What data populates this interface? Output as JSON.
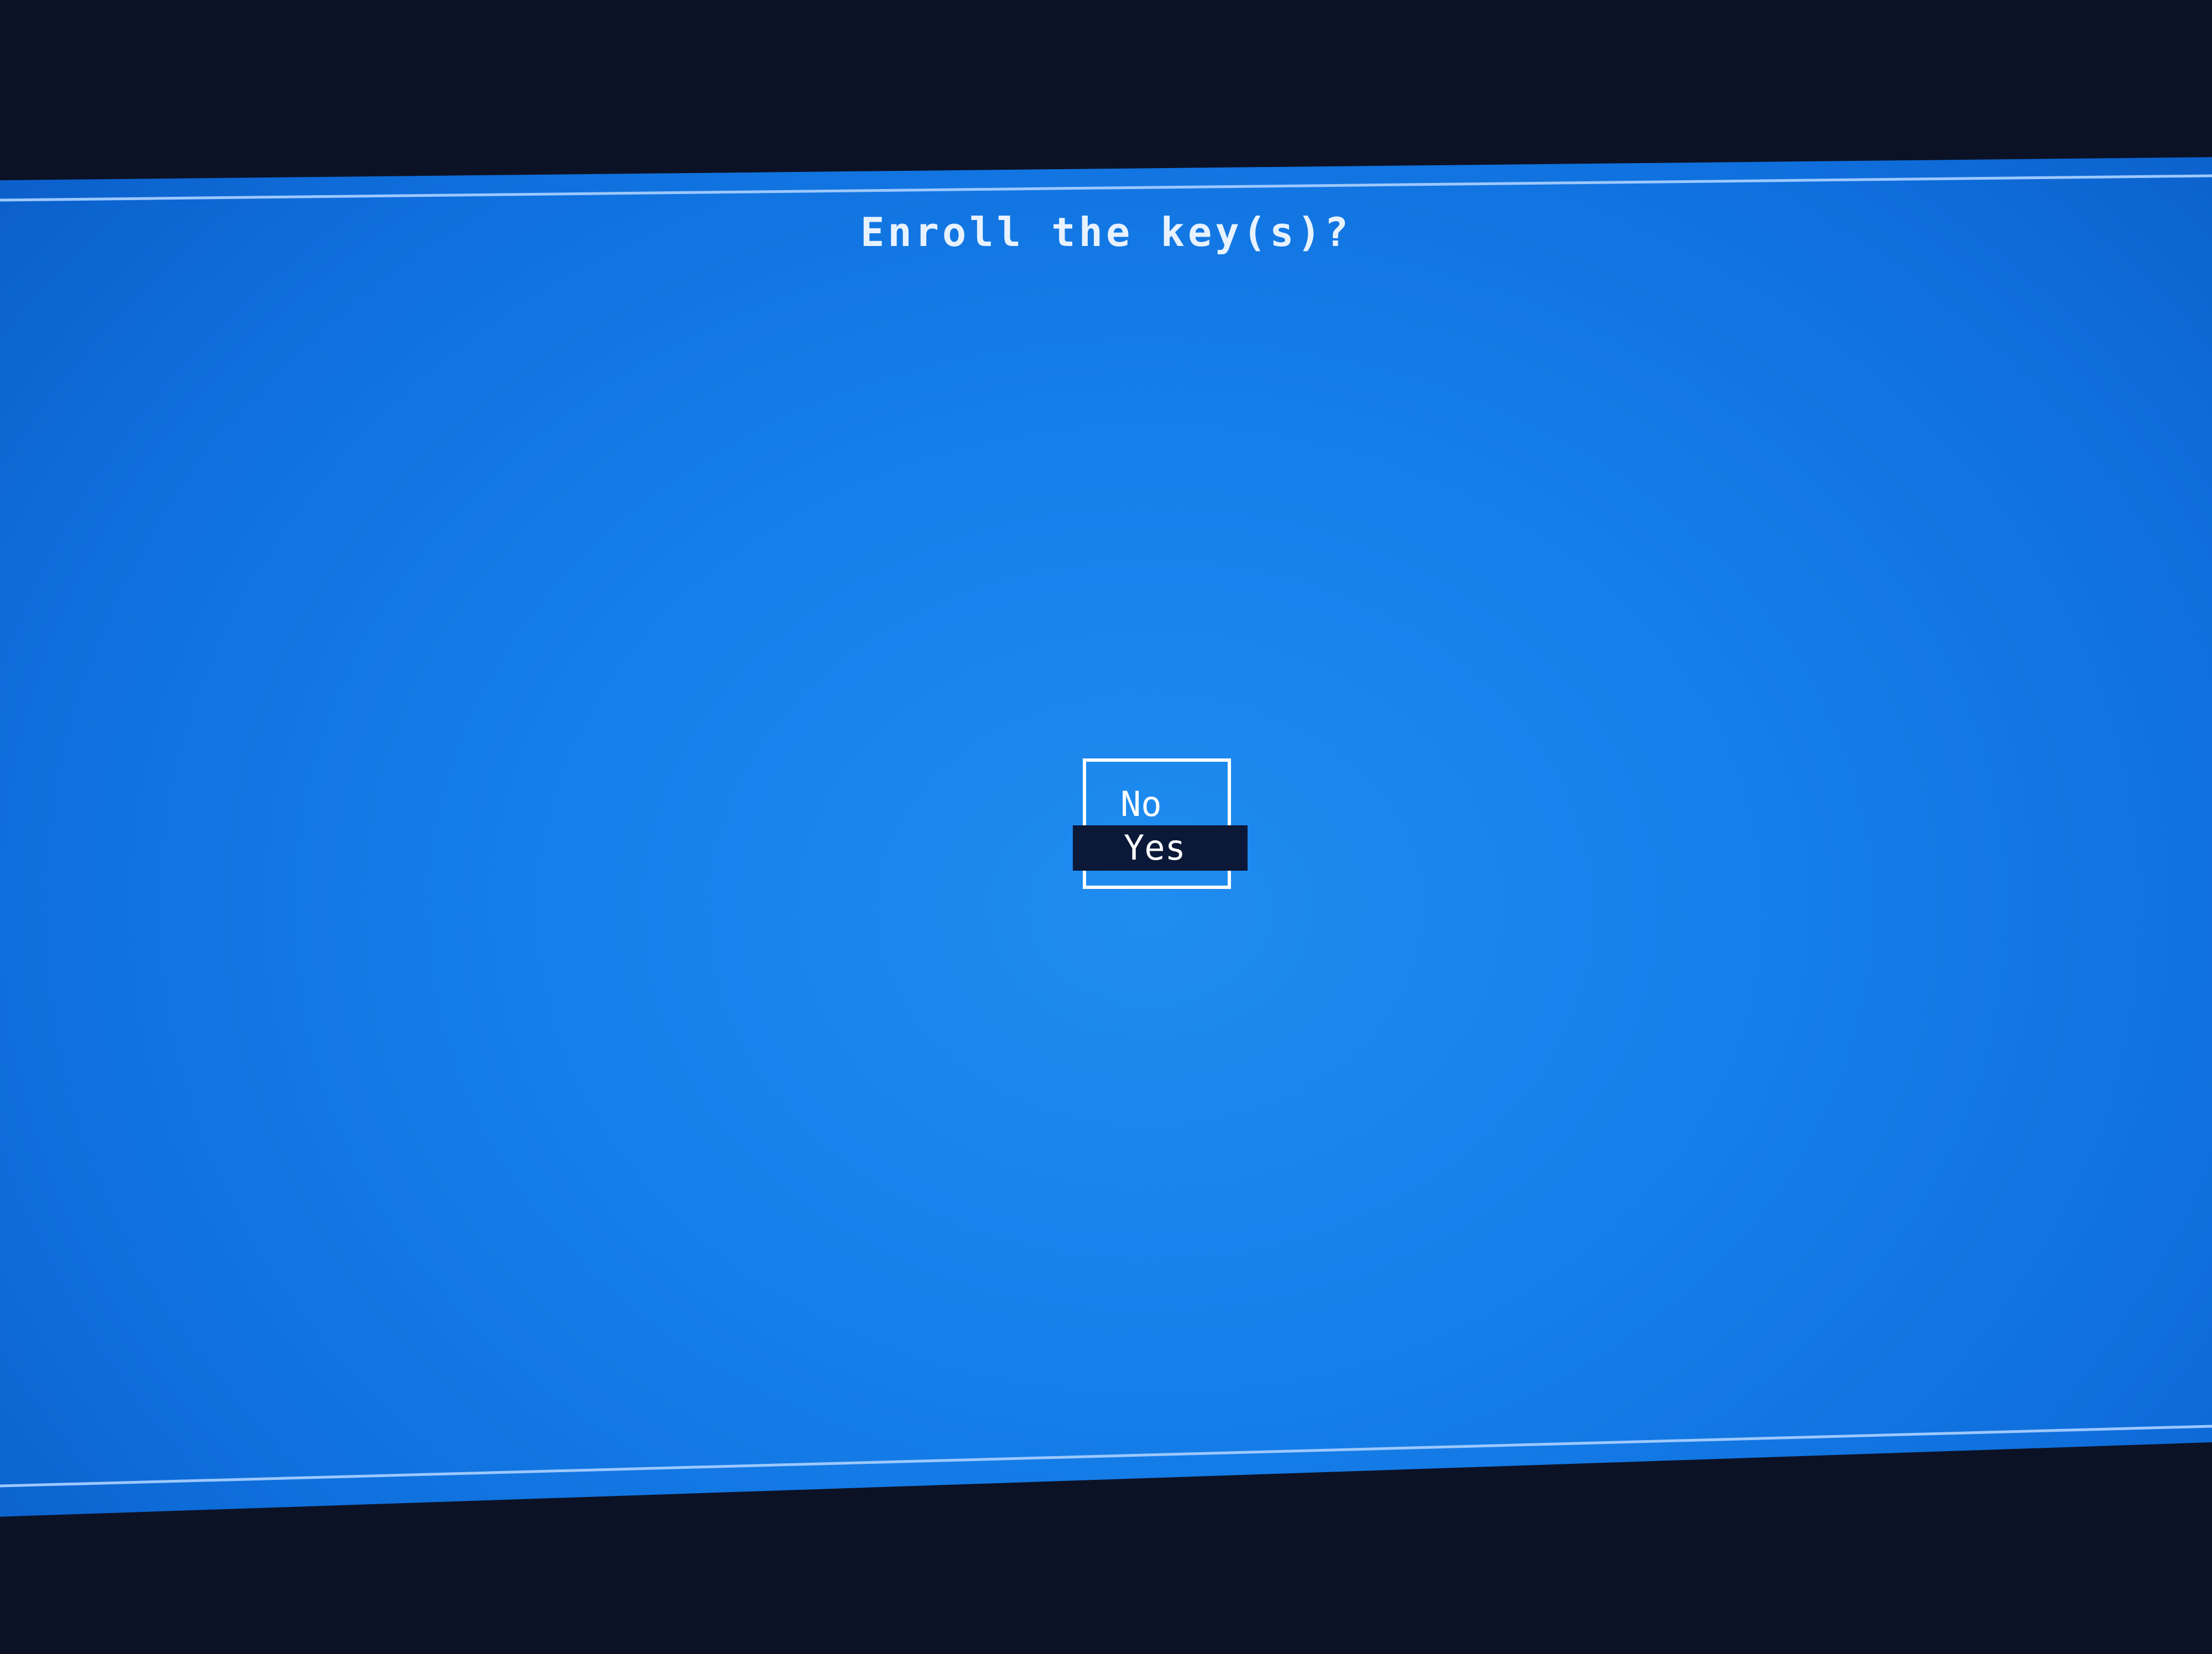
{
  "dialog": {
    "title": "Enroll the key(s)?",
    "options": [
      {
        "label": "No",
        "selected": false
      },
      {
        "label": "Yes",
        "selected": true
      }
    ]
  },
  "colors": {
    "background": "#1680ea",
    "text": "#ffffff",
    "selection": "#0b1838"
  }
}
